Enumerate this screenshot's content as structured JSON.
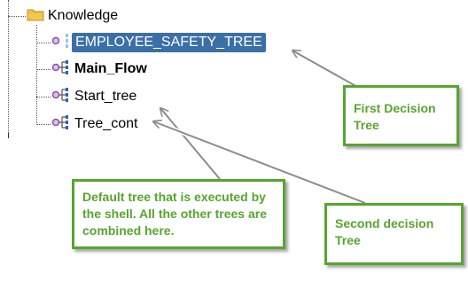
{
  "tree": {
    "root": {
      "label": "Knowledge",
      "icon": "folder-icon"
    },
    "children": [
      {
        "name": "tree-node-employee-safety-tree",
        "label": "EMPLOYEE_SAFETY_TREE",
        "icon": "decision-tree-icon",
        "selected": true,
        "bold": false
      },
      {
        "name": "tree-node-main-flow",
        "label": "Main_Flow",
        "icon": "decision-tree-icon",
        "selected": false,
        "bold": true
      },
      {
        "name": "tree-node-start-tree",
        "label": "Start_tree",
        "icon": "decision-tree-icon",
        "selected": false,
        "bold": false
      },
      {
        "name": "tree-node-tree-cont",
        "label": "Tree_cont",
        "icon": "decision-tree-icon",
        "selected": false,
        "bold": false
      }
    ]
  },
  "callouts": {
    "first_decision": "First Decision Tree",
    "default_tree": "Default tree that is  executed by the shell. All the other trees are combined here.",
    "second_decision": "Second decision Tree"
  },
  "colors": {
    "selection": "#3b6fa8",
    "callout_green": "#57a52f",
    "arrow_gray": "#8c8c8c",
    "folder_yellow": "#f2c94c",
    "icon_purple": "#8e4fa8",
    "icon_blue": "#2f62b5"
  }
}
